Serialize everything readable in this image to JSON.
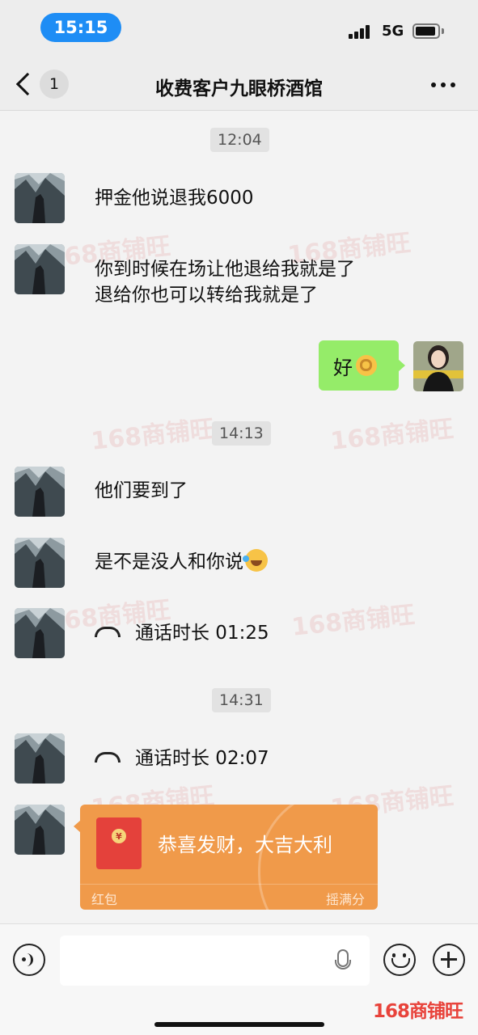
{
  "status_bar": {
    "time": "15:15",
    "network": "5G",
    "icons": [
      "signal-icon",
      "battery-icon"
    ]
  },
  "nav": {
    "back_badge": "1",
    "title": "收费客户九眼桥酒馆",
    "icons": [
      "back-icon",
      "more-icon"
    ]
  },
  "timestamps": [
    "12:04",
    "14:13",
    "14:31"
  ],
  "messages": {
    "m1": "押金他说退我6000",
    "m2_line1": "你到时候在场让他退给我就是了",
    "m2_line2": "退给你也可以转给我就是了",
    "m3": "好",
    "m4": "他们要到了",
    "m5": "是不是没人和你说",
    "call1_label": "通话时长 01:25",
    "call2_label": "通话时长 02:07"
  },
  "red_packet": {
    "greeting": "恭喜发财，大吉大利",
    "label": "红包",
    "right_text": "摇满分",
    "seal": "¥"
  },
  "watermark": "168商铺旺",
  "brand": "168商铺旺",
  "colors": {
    "outgoing_bubble": "#95ec69",
    "red_packet": "#f09a4a",
    "time_pill": "#1e8df5",
    "brand_red": "#e8433b"
  }
}
